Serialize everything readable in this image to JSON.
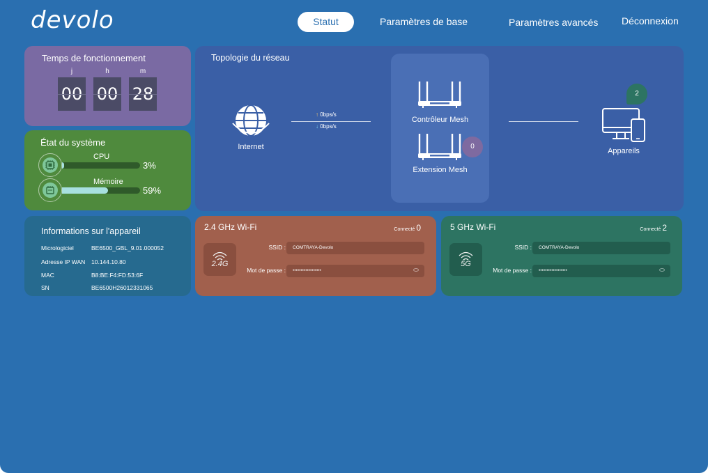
{
  "header": {
    "logo_text": "devolo",
    "nav": {
      "status": "Statut",
      "basic": "Paramètres de base",
      "advanced": "Paramètres avancés",
      "logout": "Déconnexion"
    }
  },
  "uptime": {
    "title": "Temps de fonctionnement",
    "labels": {
      "days": "j",
      "hours": "h",
      "minutes": "m"
    },
    "values": {
      "days": "00",
      "hours": "00",
      "minutes": "28"
    }
  },
  "system": {
    "title": "État du système",
    "cpu": {
      "label": "CPU",
      "percent": "3%",
      "fraction": 0.03
    },
    "memory": {
      "label": "Mémoire",
      "percent": "59%",
      "fraction": 0.59
    }
  },
  "topology": {
    "title": "Topologie du réseau",
    "internet_label": "Internet",
    "upload_rate": "0bps/s",
    "download_rate": "0bps/s",
    "controller_label": "Contrôleur Mesh",
    "extension_label": "Extension Mesh",
    "extension_count": "0",
    "devices_label": "Appareils",
    "devices_count": "2"
  },
  "device_info": {
    "title": "Informations sur l'appareil",
    "rows": [
      {
        "key": "Micrologiciel",
        "value": "BE6500_GBL_9.01.000052"
      },
      {
        "key": "Adresse IP WAN",
        "value": "10.144.10.80"
      },
      {
        "key": "MAC",
        "value": "B8:BE:F4:FD:53:6F"
      },
      {
        "key": "SN",
        "value": "BE6500H26012331065"
      }
    ]
  },
  "wifi24": {
    "title": "2.4 GHz Wi-Fi",
    "connected_label": "Connecté",
    "connected_count": "0",
    "band_text": "2.4G",
    "ssid_label": "SSID :",
    "ssid_value": "COMTRAYA-Devolo",
    "password_label": "Mot de passe :",
    "password_value": "••••••••••••••••••"
  },
  "wifi5": {
    "title": "5 GHz Wi-Fi",
    "connected_label": "Connecté",
    "connected_count": "2",
    "band_text": "5G",
    "ssid_label": "SSID :",
    "ssid_value": "COMTRAYA-Devolo",
    "password_label": "Mot de passe :",
    "password_value": "••••••••••••••••••"
  },
  "colors": {
    "background": "#2a6fb0",
    "uptime_card": "#7a6aa3",
    "system_card": "#4f8a3d",
    "topology_card": "#3a5fa6",
    "device_card": "#266a8f",
    "wifi24_card": "#a1604d",
    "wifi5_card": "#2d7462"
  },
  "icons": {
    "globe": "globe-icon",
    "router": "router-icon",
    "devices": "devices-icon",
    "cpu": "cpu-chip-icon",
    "memory": "memory-icon",
    "wifi": "wifi-icon",
    "eye": "eye-icon"
  }
}
